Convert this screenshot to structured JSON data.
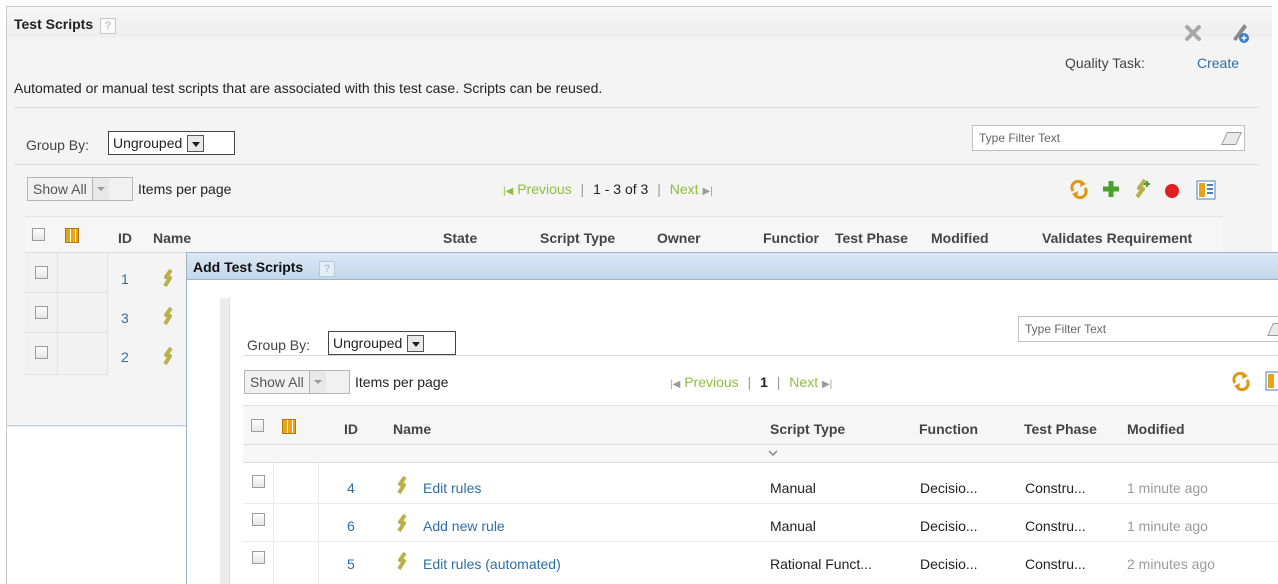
{
  "panel": {
    "title": "Test Scripts",
    "help_glyph": "?",
    "quality_task_label": "Quality Task:",
    "create_link": "Create",
    "description": "Automated or manual test scripts that are associated with this test case. Scripts can be reused.",
    "group_by_label": "Group By:",
    "group_by_value": "Ungrouped",
    "filter_placeholder": "Type Filter Text",
    "show_all": "Show All",
    "items_per_page": "Items per page",
    "pager": {
      "previous": "Previous",
      "sep1": "|",
      "range": "1 - 3 of 3",
      "sep2": "|",
      "next": "Next"
    },
    "columns": [
      "ID",
      "Name",
      "State",
      "Script Type",
      "Owner",
      "Functior",
      "Test Phase",
      "Modified",
      "Validates Requirement"
    ],
    "rows": [
      {
        "id": "1"
      },
      {
        "id": "3"
      },
      {
        "id": "2"
      }
    ]
  },
  "dialog": {
    "title": "Add Test Scripts",
    "help_glyph": "?",
    "group_by_label": "Group By:",
    "group_by_value": "Ungrouped",
    "filter_placeholder": "Type Filter Text",
    "show_all": "Show All",
    "items_per_page": "Items per page",
    "pager": {
      "previous": "Previous",
      "sep1": "|",
      "page": "1",
      "sep2": "|",
      "next": "Next"
    },
    "columns": [
      "ID",
      "Name",
      "Script Type",
      "Function",
      "Test Phase",
      "Modified"
    ],
    "rows": [
      {
        "id": "4",
        "name": "Edit rules",
        "script_type": "Manual",
        "function": "Decisio...",
        "test_phase": "Constru...",
        "modified": "1 minute ago"
      },
      {
        "id": "6",
        "name": "Add new rule",
        "script_type": "Manual",
        "function": "Decisio...",
        "test_phase": "Constru...",
        "modified": "1 minute ago"
      },
      {
        "id": "5",
        "name": "Edit rules (automated)",
        "script_type": "Rational Funct...",
        "function": "Decisio...",
        "test_phase": "Constru...",
        "modified": "2 minutes ago"
      }
    ]
  },
  "icons": [
    "close-icon",
    "edit-icon",
    "refresh-icon",
    "add-icon",
    "add-script-icon",
    "remove-icon",
    "column-config-icon",
    "eraser-icon",
    "script-icon",
    "first-page-icon",
    "last-page-icon",
    "sort-chevron-icon"
  ],
  "colors": {
    "link": "#2e6fa7",
    "pager_disabled": "#8fbf3e",
    "dialog_title_bar": "#c9dcef",
    "remove": "#e02020",
    "add": "#4aa02c"
  }
}
